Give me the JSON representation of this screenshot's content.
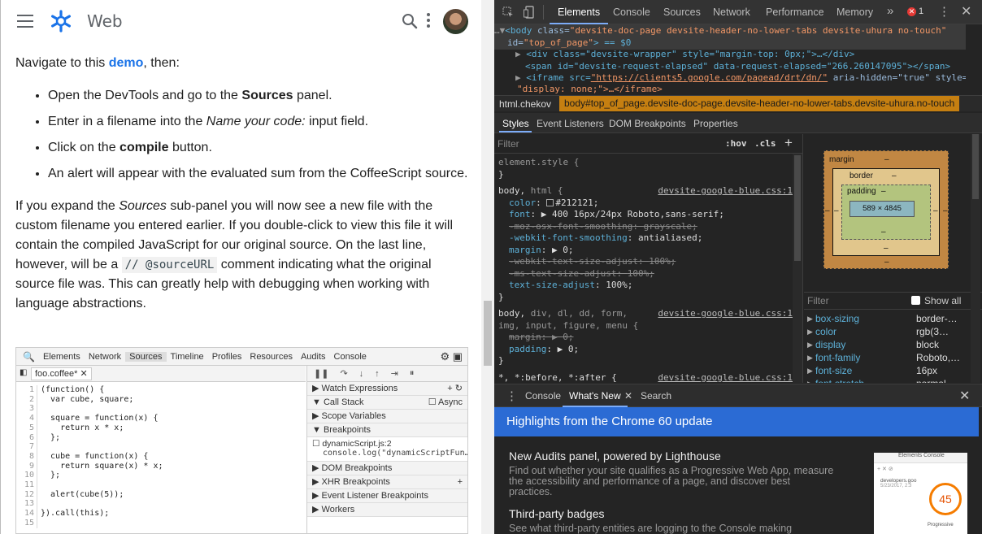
{
  "header": {
    "site_title": "Web"
  },
  "article": {
    "intro_prefix": "Navigate to this ",
    "intro_link": "demo",
    "intro_suffix": ", then:",
    "steps": [
      {
        "a": "Open the DevTools and go to the ",
        "b": "Sources",
        "c": " panel."
      },
      {
        "a": "Enter in a filename into the ",
        "b": "Name your code:",
        "c": " input field."
      },
      {
        "a": "Click on the ",
        "b": "compile",
        "c": " button."
      },
      {
        "a": "An alert will appear with the evaluated sum from the CoffeeScript source.",
        "b": "",
        "c": ""
      }
    ],
    "para_1": "If you expand the ",
    "para_em": "Sources",
    "para_2": " sub-panel you will now see a new file with the custom filename you entered earlier. If you double-click to view this file it will contain the compiled JavaScript for our original source. On the last line, however, will be a ",
    "para_code": "// @sourceURL",
    "para_3": " comment indicating what the original source file was. This can greatly help with debugging when working with language abstractions."
  },
  "screenshot": {
    "tabs": [
      "Elements",
      "Network",
      "Sources",
      "Timeline",
      "Profiles",
      "Resources",
      "Audits",
      "Console"
    ],
    "file_tab": "foo.coffee*",
    "line_numbers": [
      "1",
      "2",
      "3",
      "4",
      "5",
      "6",
      "7",
      "8",
      "9",
      "10",
      "11",
      "12",
      "13",
      "14",
      "15"
    ],
    "code_lines": [
      "(function() {",
      "  var cube, square;",
      "",
      "  square = function(x) {",
      "    return x * x;",
      "  };",
      "",
      "  cube = function(x) {",
      "    return square(x) * x;",
      "  };",
      "",
      "  alert(cube(5));",
      "",
      "}).call(this);",
      ""
    ],
    "panes": {
      "watch": "Watch Expressions",
      "call_stack": "Call Stack",
      "async": "Async",
      "scope": "Scope Variables",
      "breakpoints": "Breakpoints",
      "bp_file": "dynamicScript.js:2",
      "bp_code": "console.log(\"dynamicScriptFun…",
      "dom": "DOM Breakpoints",
      "xhr": "XHR Breakpoints",
      "listener": "Event Listener Breakpoints",
      "workers": "Workers"
    }
  },
  "devtools": {
    "tabs": [
      "Elements",
      "Console",
      "Sources",
      "Network",
      "Performance",
      "Memory"
    ],
    "more_tabs": "»",
    "error_count": "1",
    "dom": {
      "body_tag": "<body",
      "body_class_attr": "class=",
      "body_class_val": "\"devsite-doc-page devsite-header-no-lower-tabs devsite-uhura no-touch\"",
      "body_id_attr": "id=",
      "body_id_val": "\"top_of_page\"",
      "body_eq": "> == $0",
      "div_wrapper": "<div class=\"devsite-wrapper\" style=\"margin-top: 0px;\">…</div>",
      "span_elapsed": "<span id=\"devsite-request-elapsed\" data-request-elapsed=\"266.260147095\"></span>",
      "iframe_open": "<iframe src=",
      "iframe_src": "\"https://clients5.google.com/pagead/drt/dn/\"",
      "iframe_rest": " aria-hidden=\"true\" style=",
      "iframe_style": "\"display: none;\">…</iframe>"
    },
    "crumbs": [
      "html.chekov",
      "body#top_of_page.devsite-doc-page.devsite-header-no-lower-tabs.devsite-uhura.no-touch"
    ],
    "subtabs": [
      "Styles",
      "Event Listeners",
      "DOM Breakpoints",
      "Properties"
    ],
    "styles": {
      "filter_placeholder": "Filter",
      "hov": ":hov",
      "cls": ".cls",
      "element_style": "element.style {",
      "close": "}",
      "rule1_sel_main": "body,",
      "rule1_sel_dim": " html {",
      "rule1_src": "devsite-google-blue.css:1",
      "rule1_props": [
        {
          "n": "color",
          "v": "#212121;",
          "swatch": true,
          "strike": false
        },
        {
          "n": "font",
          "v": "▶ 400 16px/24px Roboto,sans-serif;",
          "strike": false
        },
        {
          "n": "-moz-osx-font-smoothing",
          "v": "grayscale;",
          "strike": true
        },
        {
          "n": "-webkit-font-smoothing",
          "v": "antialiased;",
          "strike": false
        },
        {
          "n": "margin",
          "v": "▶ 0;",
          "strike": false
        },
        {
          "n": "-webkit-text-size-adjust",
          "v": "100%;",
          "strike": true
        },
        {
          "n": "-ms-text-size-adjust",
          "v": "100%;",
          "strike": true
        },
        {
          "n": "text-size-adjust",
          "v": "100%;",
          "strike": false
        }
      ],
      "rule2_sel_main": "body,",
      "rule2_sel_dim": " div, dl, dd, form,",
      "rule2_sel_line2": "img, input, figure, menu {",
      "rule2_src": "devsite-google-blue.css:1",
      "rule2_props": [
        {
          "n": "margin",
          "v": "▶ 0;",
          "strike": true
        },
        {
          "n": "padding",
          "v": "▶ 0;",
          "strike": false
        }
      ],
      "rule3_sel": "*, *:before, *:after {",
      "rule3_src": "devsite-google-blue.css:1"
    },
    "box_model": {
      "margin": "margin",
      "border": "border",
      "padding": "padding",
      "content": "589 × 4845",
      "dash": "–"
    },
    "computed": {
      "filter_placeholder": "Filter",
      "show_all": "Show all",
      "props": [
        {
          "n": "box-sizing",
          "v": "border-…"
        },
        {
          "n": "color",
          "v": "rgb(3…"
        },
        {
          "n": "display",
          "v": "block"
        },
        {
          "n": "font-family",
          "v": "Roboto,…"
        },
        {
          "n": "font-size",
          "v": "16px"
        },
        {
          "n": "font-stretch",
          "v": "normal"
        }
      ]
    },
    "drawer": {
      "tabs": [
        "Console",
        "What's New",
        "Search"
      ],
      "banner": "Highlights from the Chrome 60 update",
      "items": [
        {
          "title": "New Audits panel, powered by Lighthouse",
          "desc": "Find out whether your site qualifies as a Progressive Web App, measure the accessibility and performance of a page, and discover best practices."
        },
        {
          "title": "Third-party badges",
          "desc": "See what third-party entities are logging to the Console making"
        }
      ],
      "thumb_tabs": "Elements   Console",
      "thumb_text": "developers.goo",
      "thumb_date": "5/23/2017, 2:3",
      "thumb_score": "45",
      "thumb_label": "Progressive"
    }
  },
  "colors": {
    "link": "#1a73e8",
    "devtools_bg": "#242424",
    "banner": "#2b6bd4",
    "tab_underline": "#7cacf8",
    "crumb_highlight": "#c57f11"
  }
}
